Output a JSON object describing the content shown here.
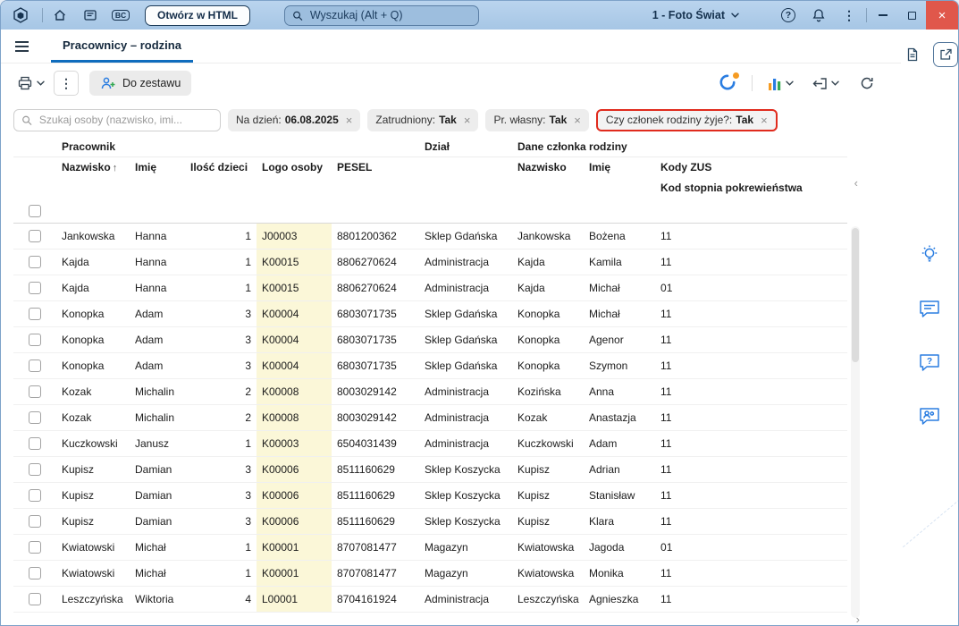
{
  "titlebar": {
    "open_html_label": "Otwórz w HTML",
    "search_placeholder": "Wyszukaj (Alt + Q)",
    "company_selector": "1 - Foto Świat",
    "bc_badge": "BC"
  },
  "tabbar": {
    "active_tab": "Pracownicy – rodzina"
  },
  "toolbar": {
    "add_to_set": "Do zestawu"
  },
  "filterbar": {
    "search_placeholder": "Szukaj osoby (nazwisko, imi...",
    "chips": [
      {
        "label": "Na dzień:",
        "value": "06.08.2025",
        "highlighted": false
      },
      {
        "label": "Zatrudniony:",
        "value": "Tak",
        "highlighted": false
      },
      {
        "label": "Pr. własny:",
        "value": "Tak",
        "highlighted": false
      },
      {
        "label": "Czy członek rodziny żyje?:",
        "value": "Tak",
        "highlighted": true
      }
    ]
  },
  "table": {
    "groups": {
      "employee": "Pracownik",
      "department": "Dział",
      "family": "Dane członka rodziny"
    },
    "columns": {
      "last_name": "Nazwisko",
      "first_name": "Imię",
      "children_count": "Ilość dzieci",
      "person_code": "Logo osoby",
      "pesel": "PESEL",
      "family_last_name": "Nazwisko",
      "family_first_name": "Imię",
      "zus_codes": "Kody ZUS",
      "kinship_code": "Kod stopnia pokrewieństwa"
    },
    "sorted_by": "Nazwisko",
    "rows": [
      [
        "Jankowska",
        "Hanna",
        "1",
        "J00003",
        "8801200362",
        "Sklep Gdańska",
        "Jankowska",
        "Bożena",
        "11"
      ],
      [
        "Kajda",
        "Hanna",
        "1",
        "K00015",
        "8806270624",
        "Administracja",
        "Kajda",
        "Kamila",
        "11"
      ],
      [
        "Kajda",
        "Hanna",
        "1",
        "K00015",
        "8806270624",
        "Administracja",
        "Kajda",
        "Michał",
        "01"
      ],
      [
        "Konopka",
        "Adam",
        "3",
        "K00004",
        "6803071735",
        "Sklep Gdańska",
        "Konopka",
        "Michał",
        "11"
      ],
      [
        "Konopka",
        "Adam",
        "3",
        "K00004",
        "6803071735",
        "Sklep Gdańska",
        "Konopka",
        "Agenor",
        "11"
      ],
      [
        "Konopka",
        "Adam",
        "3",
        "K00004",
        "6803071735",
        "Sklep Gdańska",
        "Konopka",
        "Szymon",
        "11"
      ],
      [
        "Kozak",
        "Michalin",
        "2",
        "K00008",
        "8003029142",
        "Administracja",
        "Kozińska",
        "Anna",
        "11"
      ],
      [
        "Kozak",
        "Michalin",
        "2",
        "K00008",
        "8003029142",
        "Administracja",
        "Kozak",
        "Anastazja",
        "11"
      ],
      [
        "Kuczkowski",
        "Janusz",
        "1",
        "K00003",
        "6504031439",
        "Administracja",
        "Kuczkowski",
        "Adam",
        "11"
      ],
      [
        "Kupisz",
        "Damian",
        "3",
        "K00006",
        "8511160629",
        "Sklep Koszycka",
        "Kupisz",
        "Adrian",
        "11"
      ],
      [
        "Kupisz",
        "Damian",
        "3",
        "K00006",
        "8511160629",
        "Sklep Koszycka",
        "Kupisz",
        "Stanisław",
        "11"
      ],
      [
        "Kupisz",
        "Damian",
        "3",
        "K00006",
        "8511160629",
        "Sklep Koszycka",
        "Kupisz",
        "Klara",
        "11"
      ],
      [
        "Kwiatowski",
        "Michał",
        "1",
        "K00001",
        "8707081477",
        "Magazyn",
        "Kwiatowska",
        "Jagoda",
        "01"
      ],
      [
        "Kwiatowski",
        "Michał",
        "1",
        "K00001",
        "8707081477",
        "Magazyn",
        "Kwiatowska",
        "Monika",
        "11"
      ],
      [
        "Leszczyńska",
        "Wiktoria",
        "4",
        "L00001",
        "8704161924",
        "Administracja",
        "Leszczyńska",
        "Agnieszka",
        "11"
      ]
    ]
  },
  "glyphs": {
    "kebab": "⋮",
    "close": "×",
    "help": "?",
    "sort_asc": "↑",
    "chip_remove": "×",
    "collapse_panel": "‹",
    "scroll_right": "›"
  },
  "colors": {
    "accent_blue": "#0f6cbd",
    "chip_highlight_border": "#e02b1d",
    "person_code_cell_bg": "#fbf7d8",
    "titlebar_bg": "#aecbe8",
    "close_button_bg": "#e0574b",
    "rail_icon_blue": "#2a7de1"
  }
}
